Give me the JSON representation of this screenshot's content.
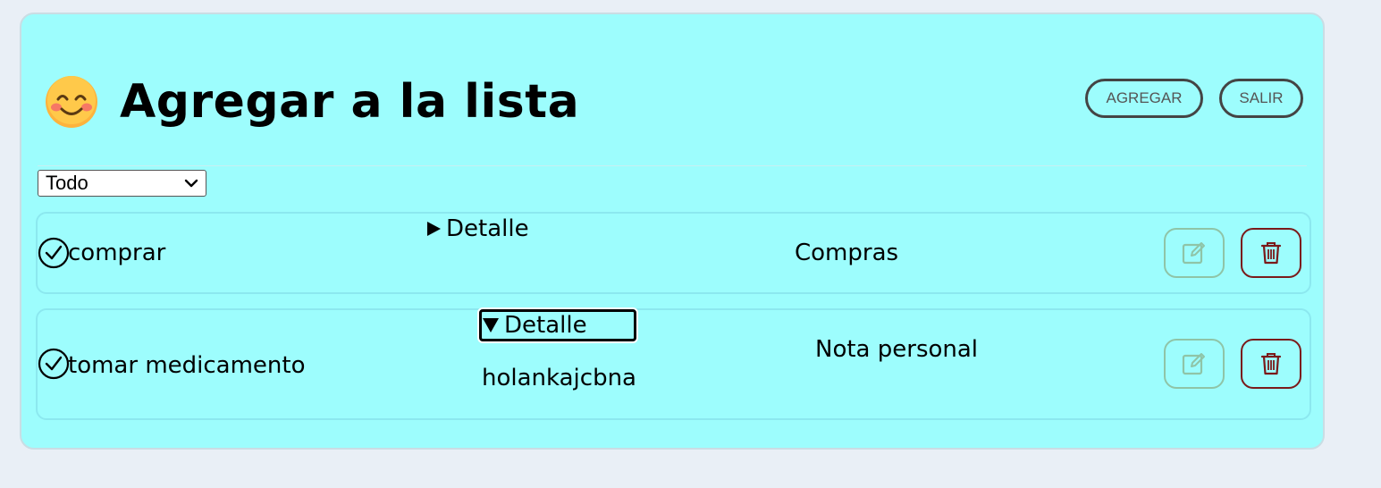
{
  "header": {
    "emoji_icon": "smiling-face-emoji",
    "title": "Agregar a la lista",
    "buttons": {
      "add_label": "AGREGAR",
      "exit_label": "SALIR"
    }
  },
  "filter": {
    "selected": "Todo"
  },
  "tasks": [
    {
      "name": "comprar",
      "details_label": "Detalle",
      "details_open": false,
      "details_body": "",
      "category": "Compras",
      "icons": {
        "status": "check-circle-icon",
        "edit": "edit-icon",
        "delete": "trash-icon"
      }
    },
    {
      "name": "tomar medicamento",
      "details_label": "Detalle",
      "details_open": true,
      "details_body": "holankajcbna",
      "category": "Nota personal",
      "icons": {
        "status": "check-circle-icon",
        "edit": "edit-icon",
        "delete": "trash-icon"
      }
    }
  ],
  "colors": {
    "card_background": "#9dfdfd",
    "page_background": "#e9eff6",
    "edit_button": "#8fc4a7",
    "delete_button": "#7a1a1a"
  }
}
